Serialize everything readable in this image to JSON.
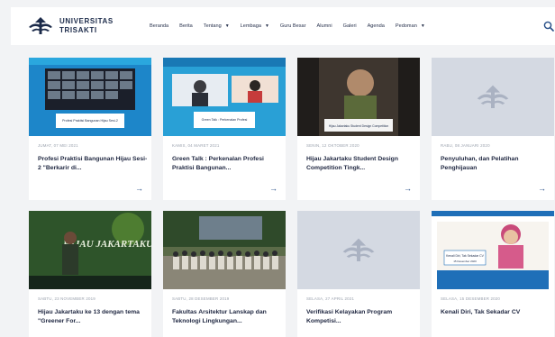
{
  "brand": {
    "line1": "UNIVERSITAS",
    "line2": "TRISAKTI"
  },
  "nav": [
    {
      "label": "Beranda",
      "dropdown": false
    },
    {
      "label": "Berita",
      "dropdown": false
    },
    {
      "label": "Tentang",
      "dropdown": true
    },
    {
      "label": "Lembaga",
      "dropdown": true
    },
    {
      "label": "Guru Besar",
      "dropdown": false
    },
    {
      "label": "Alumni",
      "dropdown": false
    },
    {
      "label": "Galeri",
      "dropdown": false
    },
    {
      "label": "Agenda",
      "dropdown": false
    },
    {
      "label": "Pedoman",
      "dropdown": true
    }
  ],
  "cards": [
    {
      "date": "JUMAT, 07 MEI 2021",
      "title": "Profesi Praktisi Bangunan Hijau Sesi-2 \"Berkarir di...",
      "thumb": "webinar-blue"
    },
    {
      "date": "KAMIS, 04 MARET 2021",
      "title": "Green Talk : Perkenalan Profesi Praktisi Bangunan...",
      "thumb": "webinar-two"
    },
    {
      "date": "SENIN, 12 OKTOBER 2020",
      "title": "Hijau Jakartaku Student Design Competition Tingk...",
      "thumb": "zoom-dark"
    },
    {
      "date": "RABU, 08 JANUARI 2020",
      "title": "Penyuluhan, dan Pelatihan Penghijauan",
      "thumb": "placeholder"
    },
    {
      "date": "SABTU, 23 NOVEMBER 2019",
      "title": "Hijau Jakartaku ke 13 dengan tema \"Greener For...",
      "thumb": "stage"
    },
    {
      "date": "SABTU, 28 DESEMBER 2019",
      "title": "Fakultas Arsitektur Lanskap dan Teknologi Lingkungan...",
      "thumb": "group-photo"
    },
    {
      "date": "SELASA, 27 APRIL 2021",
      "title": "Verifikasi Kelayakan Program Kompetisi...",
      "thumb": "placeholder"
    },
    {
      "date": "SELASA, 15 DESEMBER 2020",
      "title": "Kenali Diri, Tak Sekadar CV",
      "thumb": "speaker"
    }
  ],
  "thumb_text": {
    "c0": "Profesi Praktisi Bangunan Hijau Sesi-2",
    "c1": "Green Talk : Perkenalan Profesi",
    "c2": "Hijau Jakartaku Student Design Competition",
    "c4": "HIJAU JAKARTAKU",
    "c7a": "Kenali Diri, Tak Sekadar CV",
    "c7b": "15 Desember 2020"
  },
  "colors": {
    "brand_navy": "#1c2b4a",
    "accent_blue": "#244c86",
    "placeholder_bg": "#d4d9e2"
  }
}
